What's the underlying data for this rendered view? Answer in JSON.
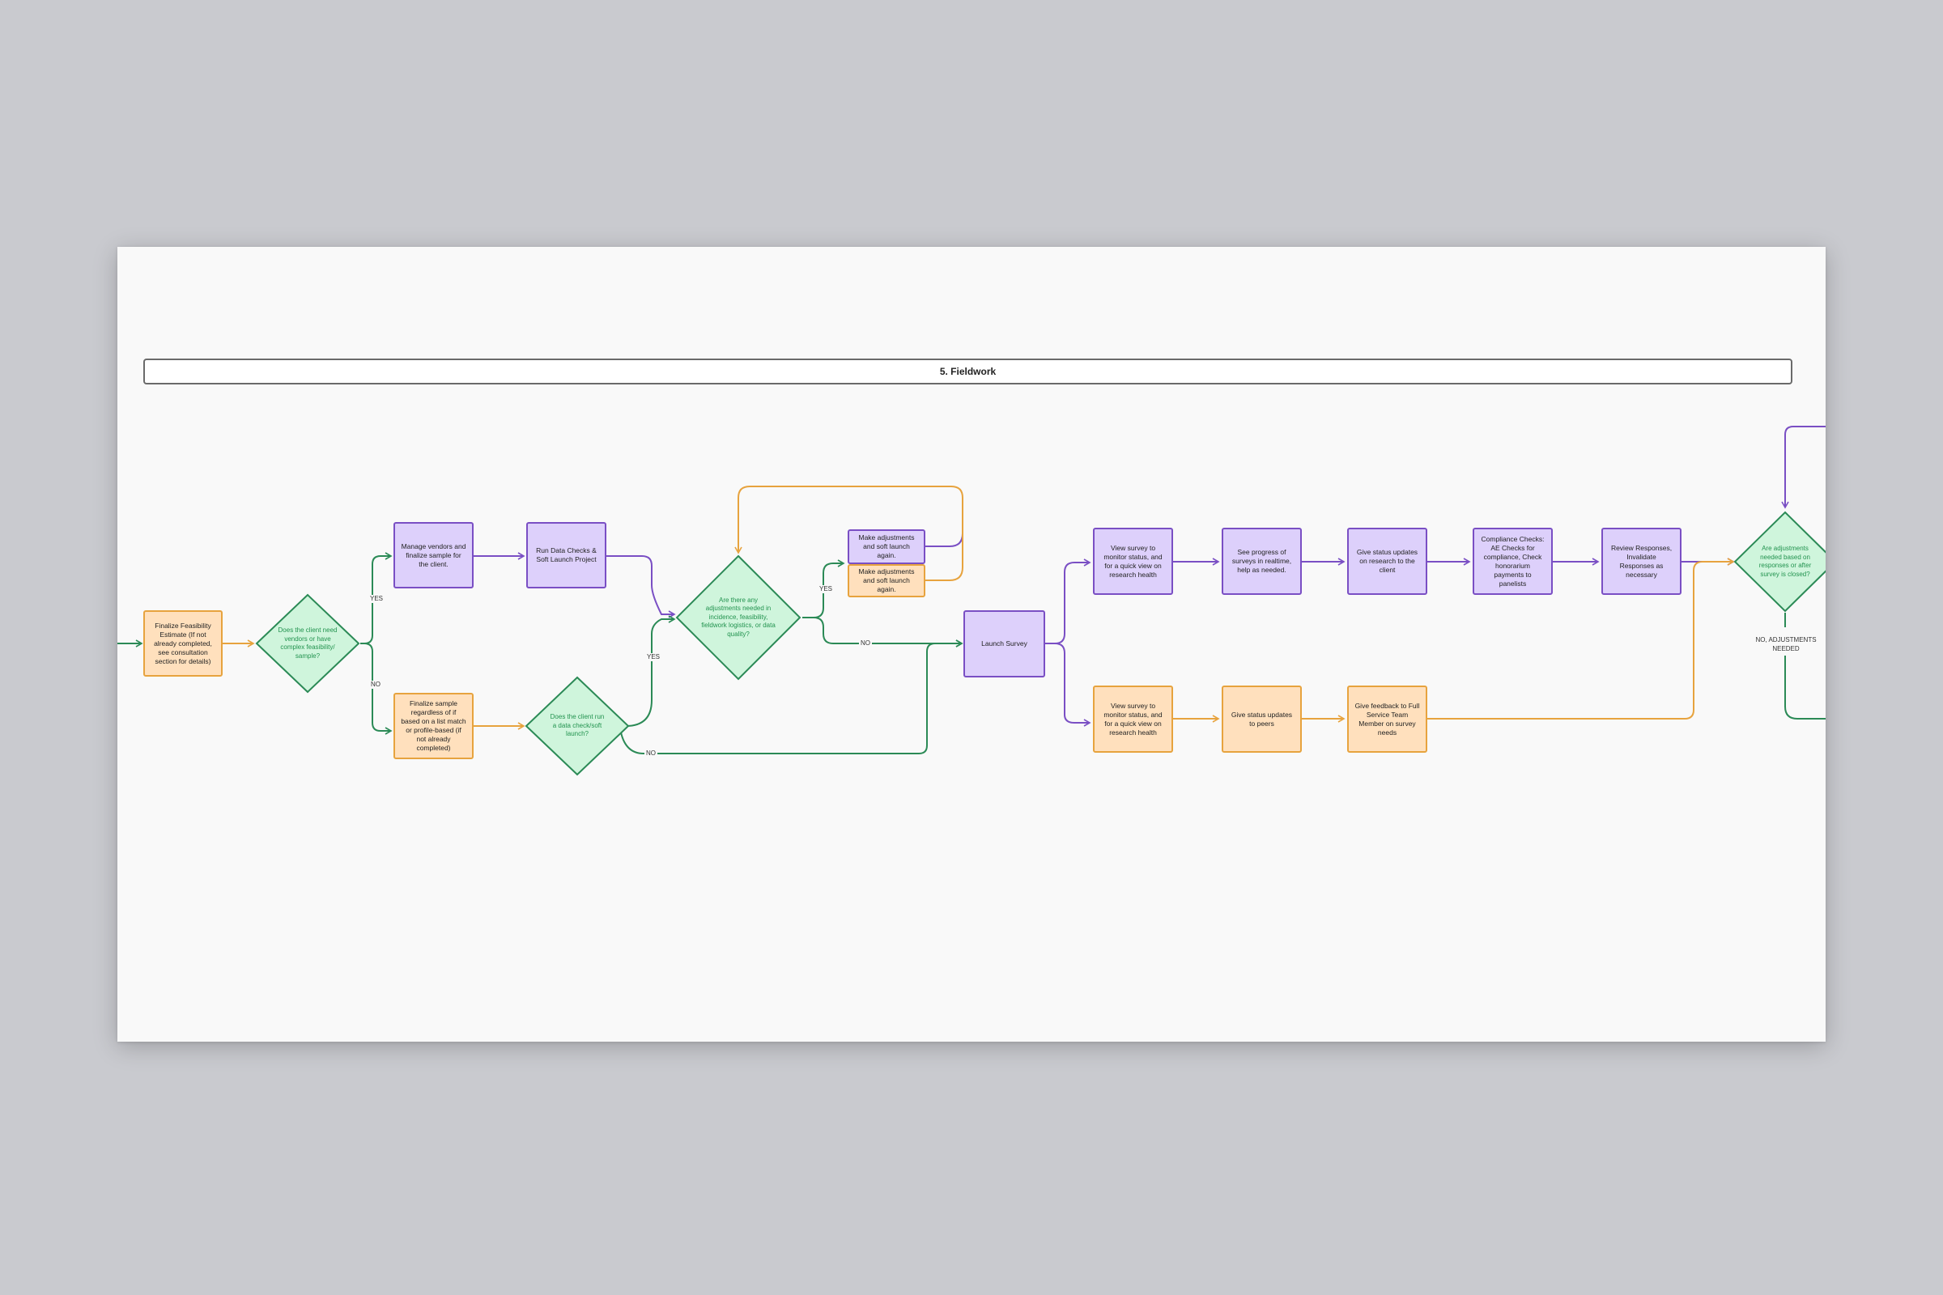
{
  "section": {
    "title": "5. Fieldwork"
  },
  "nodes": {
    "finalize_feasibility": "Finalize Feasibility Estimate (If not already completed, see consultation section for details)",
    "manage_vendors": "Manage vendors and finalize sample for the client.",
    "run_data_checks": "Run Data Checks & Soft Launch Project",
    "finalize_sample": "Finalize sample regardless of if based on a list match or profile-based (if not already completed)",
    "make_adjust_purple": "Make adjustments and soft launch again.",
    "make_adjust_orange": "Make adjustments and soft launch again.",
    "launch_survey": "Launch Survey",
    "view_survey_purple": "View survey to monitor status, and for a quick view on research health",
    "see_progress": "See progress of surveys in realtime, help as needed.",
    "give_status_client": "Give status updates on research to the client",
    "compliance_checks": "Compliance Checks: AE Checks for compliance, Check honorarium payments to panelists",
    "review_responses": "Review Responses, Invalidate Responses as necessary",
    "view_survey_orange": "View survey to monitor status, and for a quick view on research health",
    "give_status_peers": "Give status updates to peers",
    "give_feedback": "Give feedback to Full Service Team Member on survey needs"
  },
  "decisions": {
    "need_vendors": "Does the client need vendors or have complex feasibility/ sample?",
    "data_check": "Does the client run a data check/soft launch?",
    "adjustments_needed": "Are there any adjustments needed in incidence, feasibility, fieldwork logistics, or data quality?",
    "adjustments_after": "Are adjustments needed based on responses or after survey is closed?"
  },
  "labels": {
    "yes_1": "YES",
    "no_1": "NO",
    "yes_2": "YES",
    "no_2": "NO",
    "yes_3": "YES",
    "no_3": "NO",
    "no_adjust": "NO, ADJUSTMENTS NEEDED"
  },
  "colors": {
    "purple_stroke": "#7a4fc4",
    "purple_fill": "#ddd0fb",
    "orange_stroke": "#e7a33e",
    "orange_fill": "#ffe0bd",
    "green_stroke": "#2b8a56",
    "green_fill": "#cff5dc",
    "green_text": "#22934f"
  }
}
